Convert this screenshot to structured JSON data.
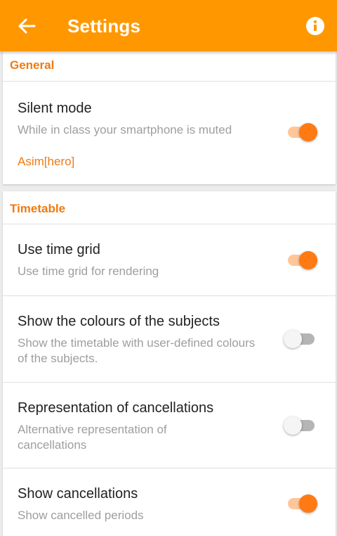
{
  "appbar": {
    "title": "Settings",
    "back_icon": "arrow-left-icon",
    "info_icon": "info-icon",
    "color": "#ff9800"
  },
  "sections": {
    "general": {
      "title": "General",
      "items": [
        {
          "title": "Silent mode",
          "summary": "While in class your smartphone is muted",
          "extra": "Asim[hero]",
          "enabled": true
        }
      ]
    },
    "timetable": {
      "title": "Timetable",
      "items": [
        {
          "title": "Use time grid",
          "summary": "Use time grid for rendering",
          "enabled": true
        },
        {
          "title": "Show the colours of the subjects",
          "summary": "Show the timetable with user-defined colours of the subjects.",
          "enabled": false
        },
        {
          "title": "Representation of cancellations",
          "summary": "Alternative representation of cancellations",
          "enabled": false
        },
        {
          "title": "Show cancellations",
          "summary": "Show cancelled periods",
          "enabled": true
        }
      ]
    }
  },
  "colors": {
    "accent": "#f07a10",
    "switch_on_thumb": "#ff7a12",
    "switch_on_track": "#ffc69a",
    "switch_off_thumb": "#f5f5f5",
    "switch_off_track": "#b5b5b5"
  }
}
